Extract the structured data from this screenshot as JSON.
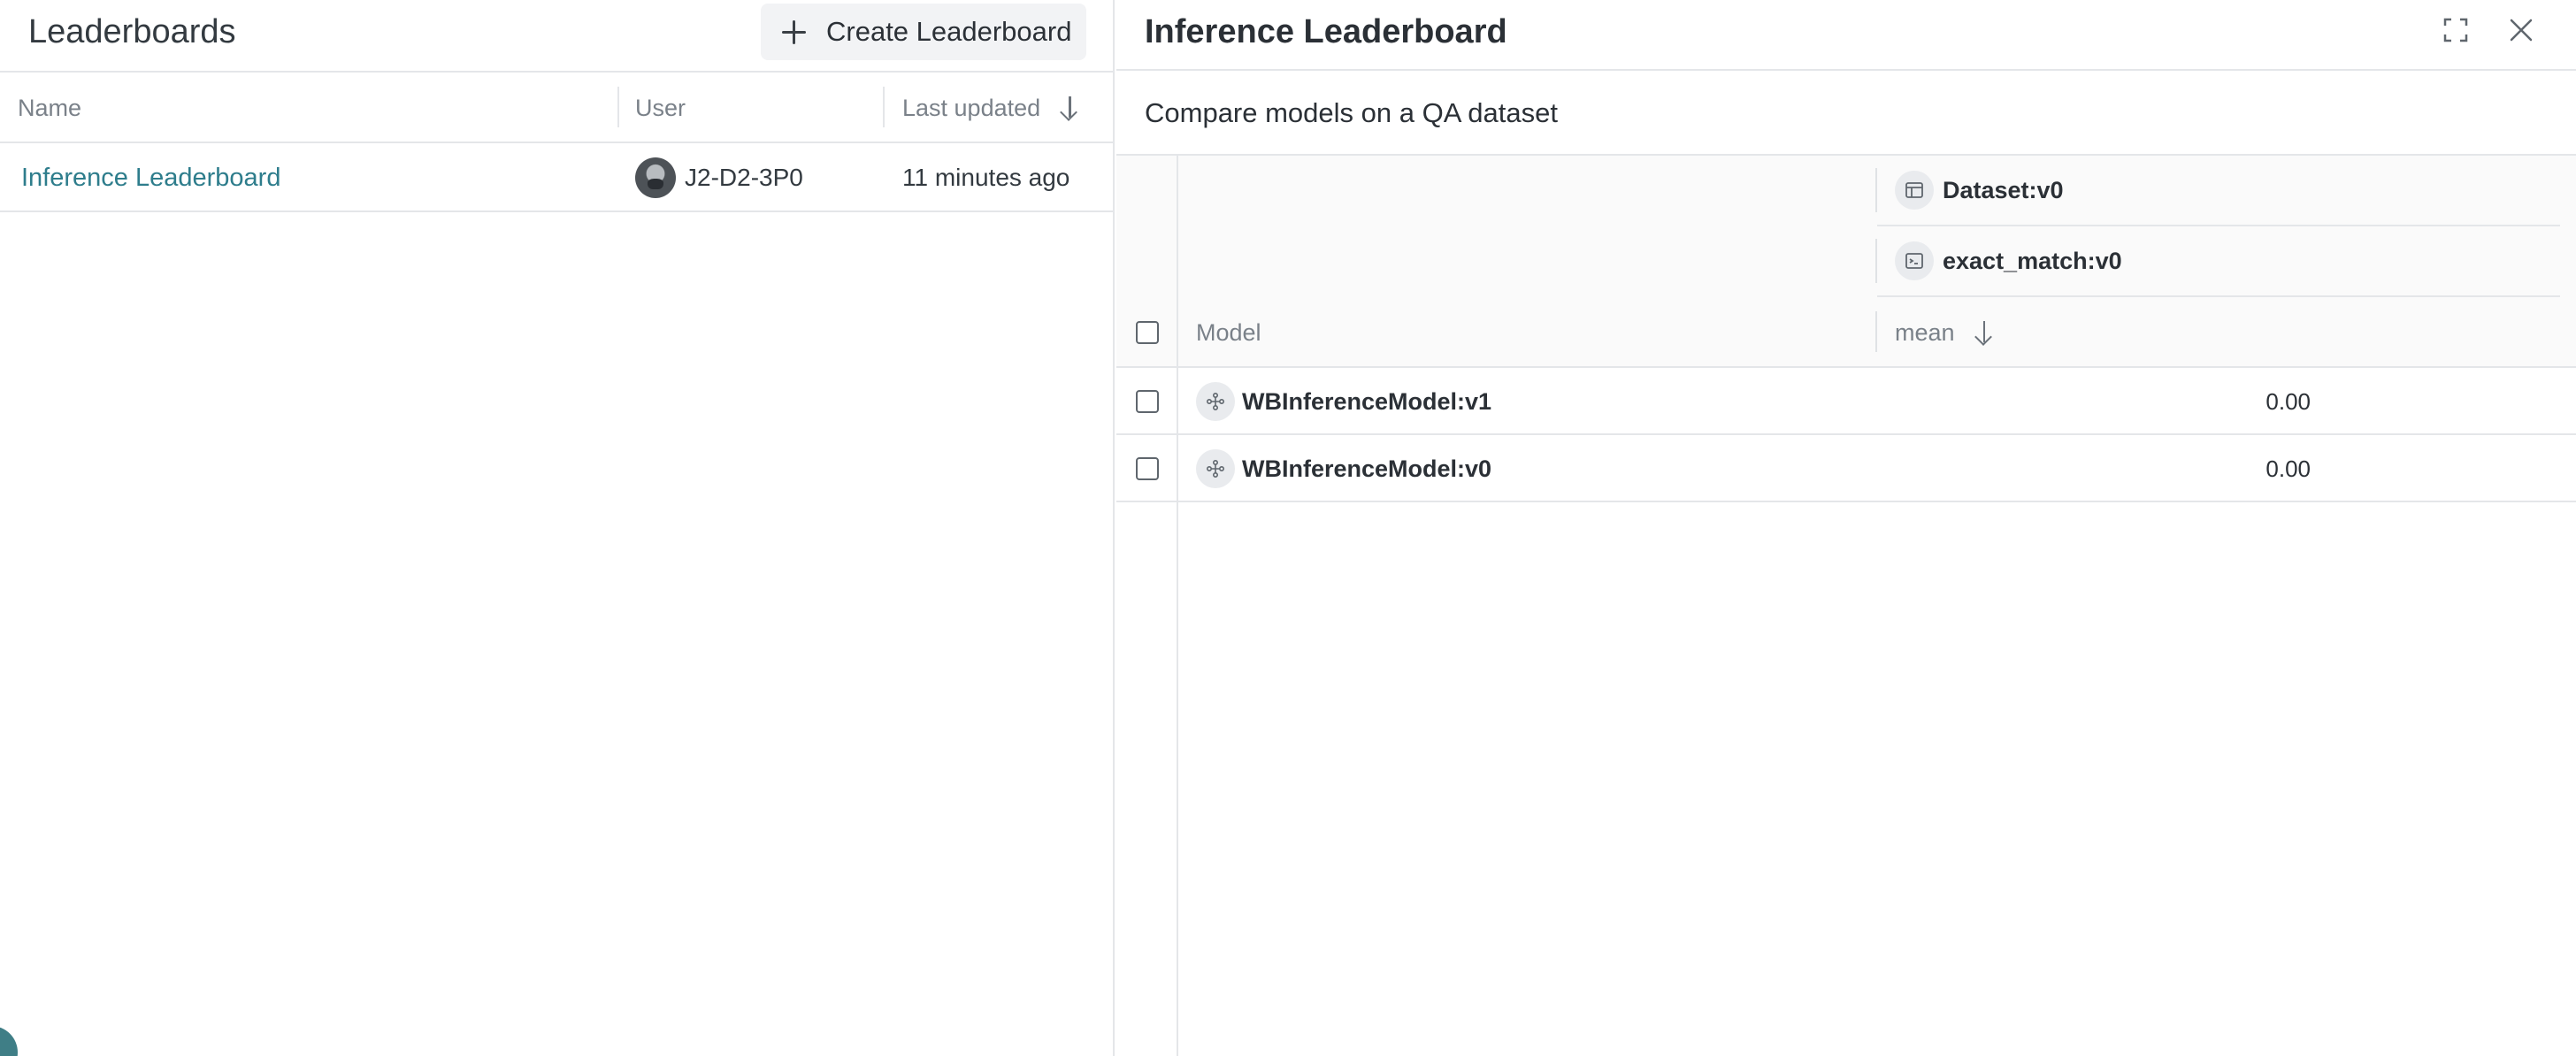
{
  "left_panel": {
    "title": "Leaderboards",
    "create_button": "Create Leaderboard",
    "columns": {
      "name": "Name",
      "user": "User",
      "last_updated": "Last updated"
    },
    "rows": [
      {
        "name": "Inference Leaderboard",
        "user": "J2-D2-3P0",
        "last_updated": "11 minutes ago"
      }
    ]
  },
  "right_panel": {
    "title": "Inference Leaderboard",
    "description": "Compare models on a QA dataset",
    "groups": {
      "dataset": "Dataset:v0",
      "scorer": "exact_match:v0"
    },
    "columns": {
      "model": "Model",
      "metric": "mean"
    },
    "rows": [
      {
        "model": "WBInferenceModel:v1",
        "mean": "0.00"
      },
      {
        "model": "WBInferenceModel:v0",
        "mean": "0.00"
      }
    ]
  },
  "colors": {
    "link": "#2e7d8c",
    "border": "#e4e6e9",
    "muted_text": "#7a8189"
  },
  "icons": [
    "plus-icon",
    "sort-down-icon",
    "fullscreen-icon",
    "close-icon",
    "dataset-icon",
    "scorer-icon",
    "model-icon",
    "avatar"
  ]
}
